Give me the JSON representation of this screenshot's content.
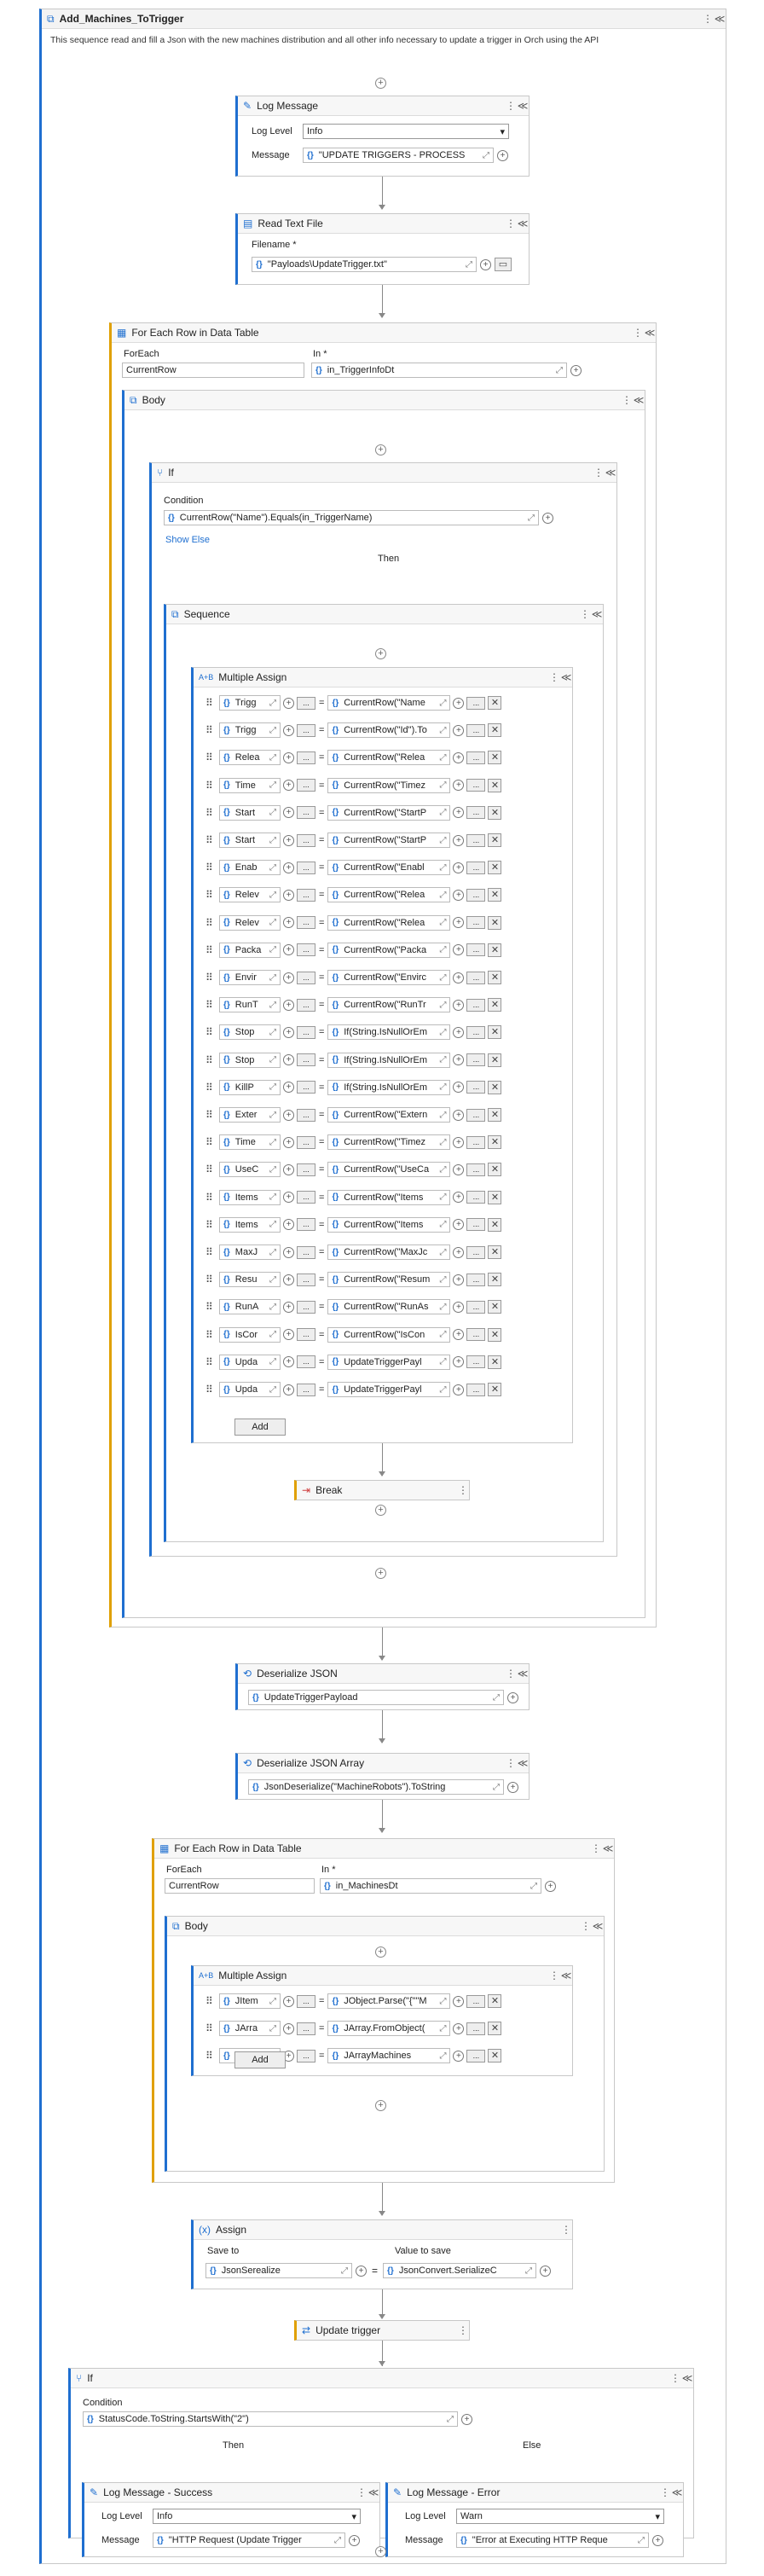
{
  "workflow": {
    "title": "Add_Machines_ToTrigger",
    "annotation": "This sequence read and fill a Json with the new machines distribution and all other info necessary to update a trigger in Orch using the API"
  },
  "log1": {
    "title": "Log Message",
    "level_label": "Log Level",
    "level": "Info",
    "message_label": "Message",
    "message": "\"UPDATE TRIGGERS - PROCESS"
  },
  "readfile": {
    "title": "Read Text File",
    "filename_label": "Filename *",
    "filename": "\"Payloads\\UpdateTrigger.txt\""
  },
  "foreach1": {
    "title": "For Each Row in Data Table",
    "foreach_label": "ForEach",
    "foreach_value": "CurrentRow",
    "in_label": "In *",
    "in_value": "in_TriggerInfoDt",
    "body": "Body"
  },
  "if1": {
    "title": "If",
    "condition_label": "Condition",
    "condition": "CurrentRow(\"Name\").Equals(in_TriggerName)",
    "show_else": "Show Else",
    "then": "Then"
  },
  "sequence": {
    "title": "Sequence"
  },
  "massign1": {
    "title": "Multiple Assign",
    "add": "Add",
    "rows": [
      {
        "left": "Trigg",
        "right": "CurrentRow(\"Name"
      },
      {
        "left": "Trigg",
        "right": "CurrentRow(\"Id\").To"
      },
      {
        "left": "Relea",
        "right": "CurrentRow(\"Relea"
      },
      {
        "left": "Time",
        "right": "CurrentRow(\"Timez"
      },
      {
        "left": "Start",
        "right": "CurrentRow(\"StartP"
      },
      {
        "left": "Start",
        "right": "CurrentRow(\"StartP"
      },
      {
        "left": "Enab",
        "right": "CurrentRow(\"Enabl"
      },
      {
        "left": "Relev",
        "right": "CurrentRow(\"Relea"
      },
      {
        "left": "Relev",
        "right": "CurrentRow(\"Relea"
      },
      {
        "left": "Packa",
        "right": "CurrentRow(\"Packa"
      },
      {
        "left": "Envir",
        "right": "CurrentRow(\"Envirc"
      },
      {
        "left": "RunT",
        "right": "CurrentRow(\"RunTr"
      },
      {
        "left": "Stop",
        "right": "If(String.IsNullOrEm"
      },
      {
        "left": "Stop",
        "right": "If(String.IsNullOrEm"
      },
      {
        "left": "KillP",
        "right": "If(String.IsNullOrEm"
      },
      {
        "left": "Exter",
        "right": "CurrentRow(\"Extern"
      },
      {
        "left": "Time",
        "right": "CurrentRow(\"Timez"
      },
      {
        "left": "UseC",
        "right": "CurrentRow(\"UseCa"
      },
      {
        "left": "Items",
        "right": "CurrentRow(\"Items"
      },
      {
        "left": "Items",
        "right": "CurrentRow(\"Items"
      },
      {
        "left": "MaxJ",
        "right": "CurrentRow(\"MaxJc"
      },
      {
        "left": "Resu",
        "right": "CurrentRow(\"Resum"
      },
      {
        "left": "RunA",
        "right": "CurrentRow(\"RunAs"
      },
      {
        "left": "IsCor",
        "right": "CurrentRow(\"IsCon"
      },
      {
        "left": "Upda",
        "right": "UpdateTriggerPayl"
      },
      {
        "left": "Upda",
        "right": "UpdateTriggerPayl"
      }
    ]
  },
  "break": {
    "title": "Break"
  },
  "deser1": {
    "title": "Deserialize JSON",
    "value": "UpdateTriggerPayload"
  },
  "deser2": {
    "title": "Deserialize JSON Array",
    "value": "JsonDeserialize(\"MachineRobots\").ToString"
  },
  "foreach2": {
    "title": "For Each Row in Data Table",
    "foreach_label": "ForEach",
    "foreach_value": "CurrentRow",
    "in_label": "In *",
    "in_value": "in_MachinesDt",
    "body": "Body"
  },
  "massign2": {
    "title": "Multiple Assign",
    "add": "Add",
    "rows": [
      {
        "left": "JItem",
        "right": "JObject.Parse(\"{\"\"M"
      },
      {
        "left": "JArra",
        "right": "JArray.FromObject("
      },
      {
        "left": "JsonI",
        "right": "JArrayMachines"
      }
    ]
  },
  "assign": {
    "title": "Assign",
    "save_label": "Save to",
    "save_value": "JsonSerealize",
    "value_label": "Value to save",
    "value": "JsonConvert.SerializeC"
  },
  "update": {
    "title": "Update trigger"
  },
  "if2": {
    "title": "If",
    "condition_label": "Condition",
    "condition": "StatusCode.ToString.StartsWith(\"2\")",
    "then": "Then",
    "else": "Else"
  },
  "logok": {
    "title": "Log Message - Success",
    "level_label": "Log Level",
    "level": "Info",
    "message_label": "Message",
    "message": "\"HTTP Request (Update Trigger"
  },
  "logerr": {
    "title": "Log Message - Error",
    "level_label": "Log Level",
    "level": "Warn",
    "message_label": "Message",
    "message": "\"Error at Executing HTTP Reque"
  }
}
